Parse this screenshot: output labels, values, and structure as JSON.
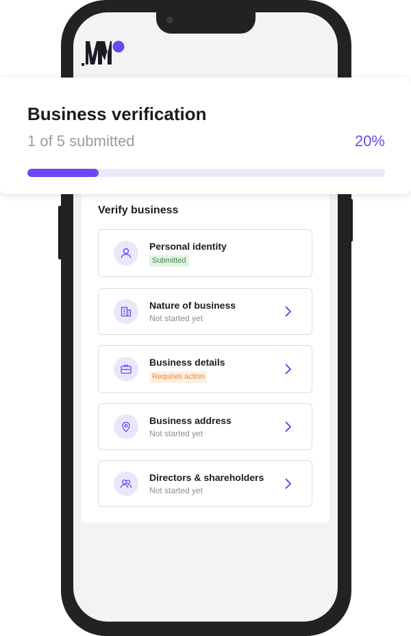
{
  "brand": {
    "accent": "#6c47f5",
    "logo_name": "M"
  },
  "header": {
    "title": "Business verification",
    "progress_text": "1 of 5 submitted",
    "percent_label": "20%",
    "progress_fraction": 0.2
  },
  "card": {
    "title": "Verify business",
    "items": [
      {
        "title": "Personal identity",
        "status": "Submitted",
        "status_type": "success",
        "icon": "user-icon",
        "has_chevron": false
      },
      {
        "title": "Nature of business",
        "status": "Not started yet",
        "status_type": "muted",
        "icon": "building-icon",
        "has_chevron": true
      },
      {
        "title": "Business details",
        "status": "Requires action",
        "status_type": "warning",
        "icon": "briefcase-icon",
        "has_chevron": true
      },
      {
        "title": "Business address",
        "status": "Not started yet",
        "status_type": "muted",
        "icon": "location-pin-icon",
        "has_chevron": true
      },
      {
        "title": "Directors & shareholders",
        "status": "Not started yet",
        "status_type": "muted",
        "icon": "users-icon",
        "has_chevron": true
      }
    ]
  }
}
